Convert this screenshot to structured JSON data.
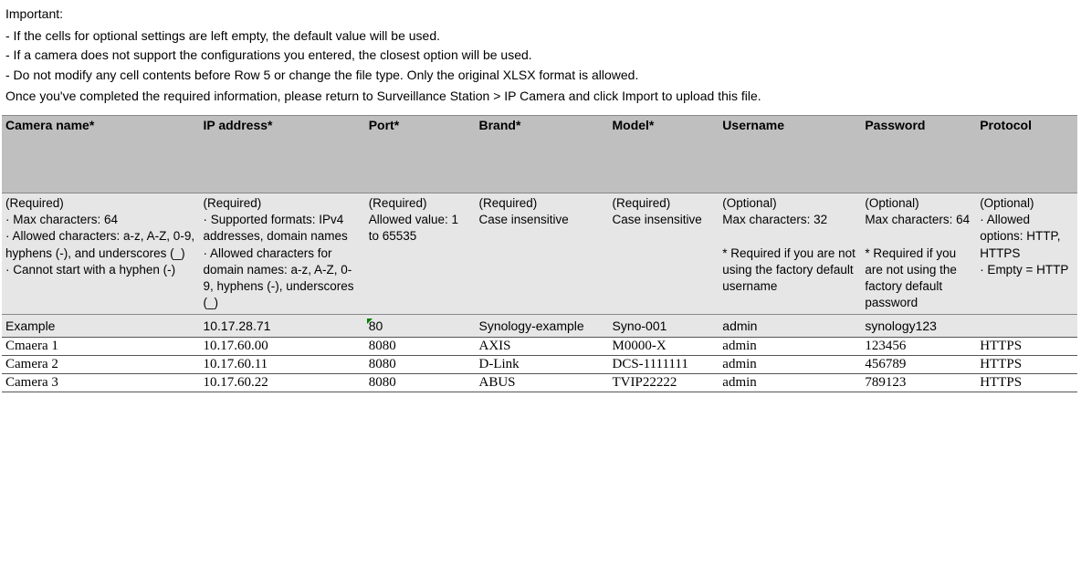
{
  "intro": {
    "heading": "Important:",
    "bullet1": "- If the cells for optional settings are left empty, the default value will be used.",
    "bullet2": "- If a camera does not support the configurations you entered, the closest option will be used.",
    "bullet3": "- Do not modify any cell contents before Row 5 or change the file type. Only the original XLSX format is allowed.",
    "footer": "Once you've completed the required information, please return to Surveillance Station > IP Camera and click Import to upload this file."
  },
  "headers": {
    "camera_name": "Camera name*",
    "ip": "IP address*",
    "port": "Port*",
    "brand": "Brand*",
    "model": "Model*",
    "username": "Username",
    "password": "Password",
    "protocol": "Protocol"
  },
  "desc": {
    "camera_name": "(Required)\n · Max characters: 64\n · Allowed characters: a-z, A-Z, 0-9, hyphens (-), and underscores (_)\n · Cannot start with a hyphen (-)",
    "ip": "(Required)\n · Supported formats: IPv4 addresses, domain names\n · Allowed characters for domain names: a-z, A-Z, 0-9, hyphens (-), underscores (_)",
    "port": "(Required)\nAllowed value: 1 to 65535",
    "brand": "(Required)\nCase insensitive",
    "model": "(Required)\nCase insensitive",
    "username": "(Optional)\nMax characters: 32\n\n* Required if you are not using the factory default username",
    "password": "(Optional)\nMax characters: 64\n\n* Required if you are not using the factory default password",
    "protocol": "(Optional)\n · Allowed options: HTTP, HTTPS\n · Empty = HTTP"
  },
  "example": {
    "camera_name": "Example",
    "ip": "10.17.28.71",
    "port": "80",
    "brand": "Synology-example",
    "model": "Syno-001",
    "username": "admin",
    "password": "synology123",
    "protocol": ""
  },
  "rows": [
    {
      "camera_name": "Cmaera 1",
      "ip": "10.17.60.00",
      "port": "8080",
      "brand": "AXIS",
      "model": "M0000-X",
      "username": "admin",
      "password": "123456",
      "protocol": "HTTPS"
    },
    {
      "camera_name": "Camera 2",
      "ip": "10.17.60.11",
      "port": "8080",
      "brand": "D-Link",
      "model": "DCS-1111111",
      "username": "admin",
      "password": "456789",
      "protocol": "HTTPS"
    },
    {
      "camera_name": "Camera 3",
      "ip": "10.17.60.22",
      "port": "8080",
      "brand": "ABUS",
      "model": "TVIP22222",
      "username": "admin",
      "password": "789123",
      "protocol": "HTTPS"
    }
  ]
}
